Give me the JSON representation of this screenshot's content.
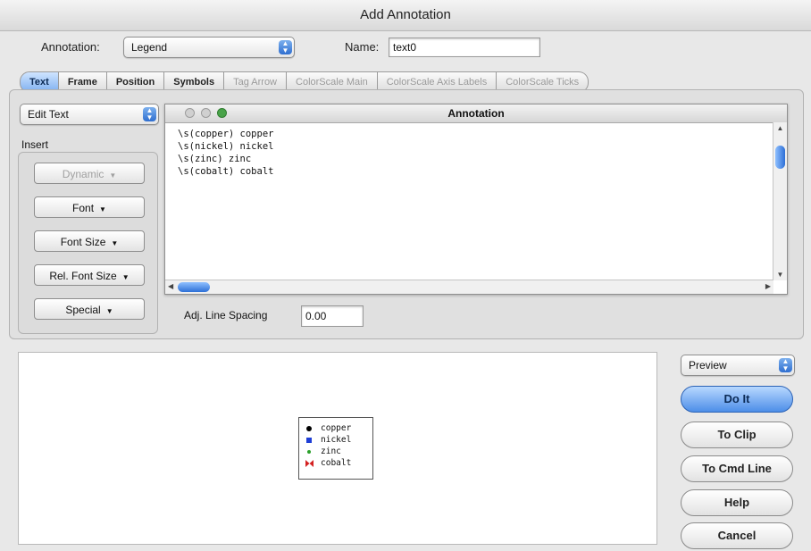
{
  "window": {
    "title": "Add Annotation"
  },
  "header": {
    "annotation_label": "Annotation:",
    "annotation_value": "Legend",
    "name_label": "Name:",
    "name_value": "text0"
  },
  "tabs": [
    {
      "label": "Text",
      "state": "active"
    },
    {
      "label": "Frame",
      "state": "enabled"
    },
    {
      "label": "Position",
      "state": "enabled"
    },
    {
      "label": "Symbols",
      "state": "enabled"
    },
    {
      "label": "Tag Arrow",
      "state": "disabled"
    },
    {
      "label": "ColorScale Main",
      "state": "disabled"
    },
    {
      "label": "ColorScale Axis Labels",
      "state": "disabled"
    },
    {
      "label": "ColorScale Ticks",
      "state": "disabled"
    }
  ],
  "left_panel": {
    "mode_value": "Edit Text",
    "insert_label": "Insert",
    "buttons": [
      "Dynamic",
      "Font",
      "Font Size",
      "Rel. Font Size",
      "Special"
    ]
  },
  "editor": {
    "title": "Annotation",
    "lines": [
      "\\s(copper) copper",
      "\\s(nickel) nickel",
      "\\s(zinc) zinc",
      "\\s(cobalt) cobalt"
    ]
  },
  "line_spacing": {
    "label": "Adj. Line Spacing",
    "value": "0.00"
  },
  "legend": {
    "entries": [
      {
        "label": "copper",
        "symbol": "circle",
        "color": "#000000"
      },
      {
        "label": "nickel",
        "symbol": "square",
        "color": "#1f3fd6"
      },
      {
        "label": "zinc",
        "symbol": "circle",
        "color": "#2aa02a"
      },
      {
        "label": "cobalt",
        "symbol": "bowtie",
        "color": "#d42020"
      }
    ]
  },
  "actions": {
    "preview_value": "Preview",
    "do_it": "Do It",
    "to_clip": "To Clip",
    "to_cmd_line": "To Cmd Line",
    "help": "Help",
    "cancel": "Cancel"
  },
  "colors": {
    "accent": "#4d8ee8",
    "active_tab": "#7fb0f0"
  }
}
